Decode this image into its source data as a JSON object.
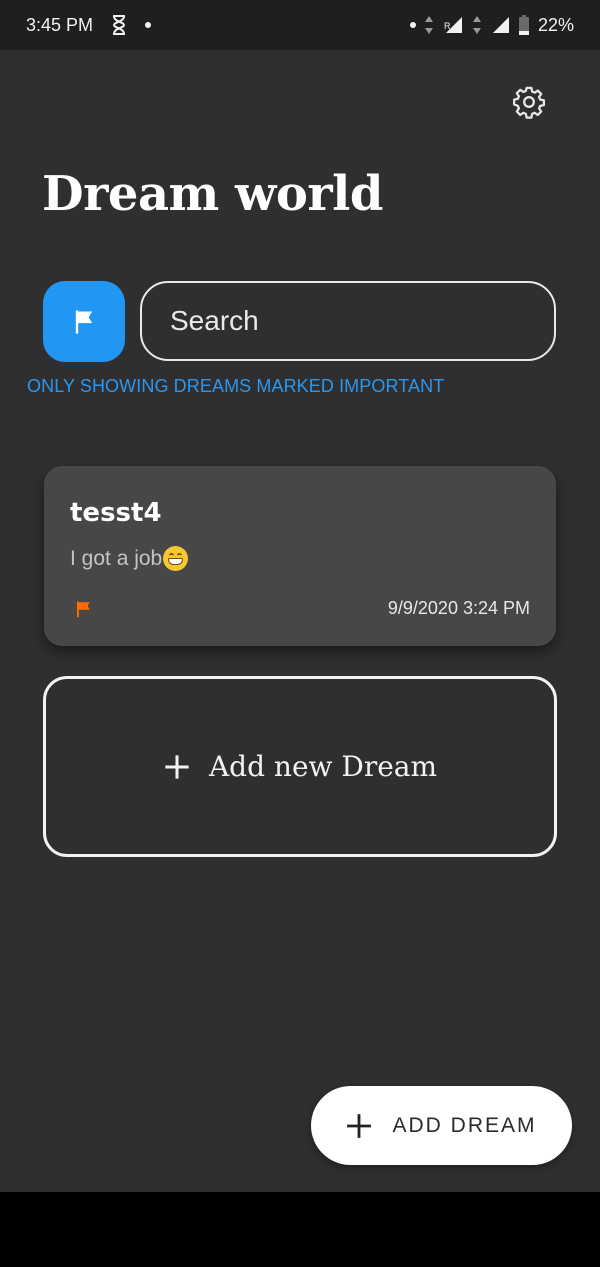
{
  "status_bar": {
    "time": "3:45 PM",
    "battery": "22%",
    "icons": [
      "hourglass-icon",
      "notification-dot-icon",
      "data-arrows-icon",
      "signal-roaming-icon",
      "signal-icon",
      "battery-icon"
    ]
  },
  "header": {
    "title": "Dream world",
    "settings_icon": "gear-icon"
  },
  "filter": {
    "flag_icon": "flag-icon",
    "flag_button_color": "#2196f3",
    "active": true
  },
  "search": {
    "placeholder": "Search",
    "value": "",
    "icon": "search-icon"
  },
  "filter_notice": "ONLY SHOWING DREAMS MARKED IMPORTANT",
  "dreams": [
    {
      "title": "tesst4",
      "body": "I got a job",
      "emoji": "grinning-face-emoji",
      "flag_color": "#ff6d00",
      "date": "9/9/2020 3:24 PM"
    }
  ],
  "add_card": {
    "label": "Add new Dream",
    "icon": "plus-icon"
  },
  "fab": {
    "label": "ADD DREAM",
    "icon": "plus-icon"
  },
  "colors": {
    "background": "#2f2f31",
    "card": "#474748",
    "accent": "#2196f3",
    "notice": "#2d97ec",
    "important_flag": "#ff6d00"
  }
}
